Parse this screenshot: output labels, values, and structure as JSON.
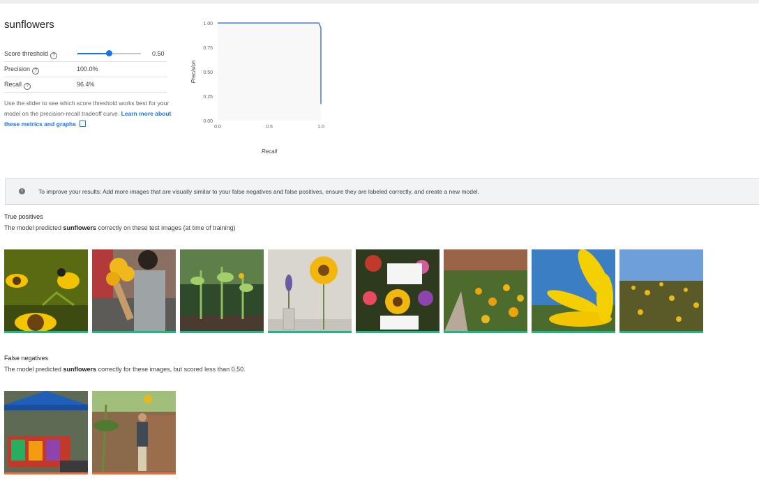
{
  "label_name": "sunflowers",
  "metrics": {
    "score_threshold_label": "Score threshold",
    "score_threshold_value": "0.50",
    "score_threshold_fraction": 0.5,
    "precision_label": "Precision",
    "precision_value": "100.0%",
    "recall_label": "Recall",
    "recall_value": "96.4%",
    "help_glyph": "?"
  },
  "hint": {
    "text": "Use the slider to see which score threshold works best for your model on the precision-recall tradeoff curve.",
    "link_text": "Learn more about these metrics and graphs"
  },
  "chart_data": {
    "type": "line",
    "title": "",
    "xlabel": "Recall",
    "ylabel": "Precision",
    "xlim": [
      0,
      1
    ],
    "ylim": [
      0,
      1
    ],
    "x_ticks": [
      "0.0",
      "0.5",
      "1.0"
    ],
    "y_ticks": [
      "0.00",
      "0.25",
      "0.50",
      "0.75",
      "1.00"
    ],
    "series": [
      {
        "color": "#4a7cc4",
        "points": [
          [
            0.0,
            1.0
          ],
          [
            0.98,
            1.0
          ],
          [
            1.0,
            0.95
          ],
          [
            1.0,
            0.17
          ]
        ]
      }
    ],
    "background": "#f8f8f8"
  },
  "banner": {
    "icon": "info-icon",
    "text": "To improve your results: Add more images that are visually similar to your false negatives and false positives, ensure they are labeled correctly, and create a new model."
  },
  "true_positives": {
    "title": "True positives",
    "desc_before": "The model predicted ",
    "desc_label": "sunflowers",
    "desc_after": " correctly on these test images (at time of training)",
    "bar_color": "#1eb980",
    "images": [
      "goldfinch-on-sunflower-image",
      "woman-holding-sunflower-bouquet-image",
      "young-sunflower-plants-image",
      "sunflower-in-vase-image",
      "flower-arrangement-image",
      "garden-border-flowers-image",
      "sunflower-petals-closeup-image",
      "sunflower-field-image"
    ]
  },
  "false_negatives": {
    "title": "False negatives",
    "desc_before": "The model predicted ",
    "desc_label": "sunflowers",
    "desc_after": " correctly for these images, but scored less than 0.50.",
    "bar_color": "#f06b3c",
    "images": [
      "market-stall-tent-image",
      "man-beside-tall-sunflower-image"
    ]
  },
  "colors": {
    "accent": "#1a73e8",
    "true_positive": "#1eb980",
    "false_negative": "#f06b3c"
  }
}
